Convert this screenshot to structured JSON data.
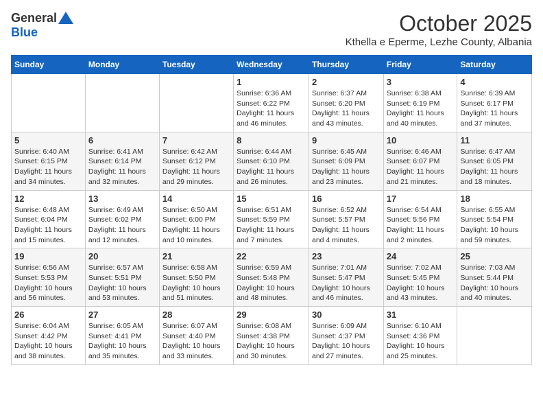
{
  "logo": {
    "general": "General",
    "blue": "Blue"
  },
  "title": "October 2025",
  "location": "Kthella e Eperme, Lezhe County, Albania",
  "weekdays": [
    "Sunday",
    "Monday",
    "Tuesday",
    "Wednesday",
    "Thursday",
    "Friday",
    "Saturday"
  ],
  "weeks": [
    [
      {
        "day": "",
        "info": ""
      },
      {
        "day": "",
        "info": ""
      },
      {
        "day": "",
        "info": ""
      },
      {
        "day": "1",
        "info": "Sunrise: 6:36 AM\nSunset: 6:22 PM\nDaylight: 11 hours and 46 minutes."
      },
      {
        "day": "2",
        "info": "Sunrise: 6:37 AM\nSunset: 6:20 PM\nDaylight: 11 hours and 43 minutes."
      },
      {
        "day": "3",
        "info": "Sunrise: 6:38 AM\nSunset: 6:19 PM\nDaylight: 11 hours and 40 minutes."
      },
      {
        "day": "4",
        "info": "Sunrise: 6:39 AM\nSunset: 6:17 PM\nDaylight: 11 hours and 37 minutes."
      }
    ],
    [
      {
        "day": "5",
        "info": "Sunrise: 6:40 AM\nSunset: 6:15 PM\nDaylight: 11 hours and 34 minutes."
      },
      {
        "day": "6",
        "info": "Sunrise: 6:41 AM\nSunset: 6:14 PM\nDaylight: 11 hours and 32 minutes."
      },
      {
        "day": "7",
        "info": "Sunrise: 6:42 AM\nSunset: 6:12 PM\nDaylight: 11 hours and 29 minutes."
      },
      {
        "day": "8",
        "info": "Sunrise: 6:44 AM\nSunset: 6:10 PM\nDaylight: 11 hours and 26 minutes."
      },
      {
        "day": "9",
        "info": "Sunrise: 6:45 AM\nSunset: 6:09 PM\nDaylight: 11 hours and 23 minutes."
      },
      {
        "day": "10",
        "info": "Sunrise: 6:46 AM\nSunset: 6:07 PM\nDaylight: 11 hours and 21 minutes."
      },
      {
        "day": "11",
        "info": "Sunrise: 6:47 AM\nSunset: 6:05 PM\nDaylight: 11 hours and 18 minutes."
      }
    ],
    [
      {
        "day": "12",
        "info": "Sunrise: 6:48 AM\nSunset: 6:04 PM\nDaylight: 11 hours and 15 minutes."
      },
      {
        "day": "13",
        "info": "Sunrise: 6:49 AM\nSunset: 6:02 PM\nDaylight: 11 hours and 12 minutes."
      },
      {
        "day": "14",
        "info": "Sunrise: 6:50 AM\nSunset: 6:00 PM\nDaylight: 11 hours and 10 minutes."
      },
      {
        "day": "15",
        "info": "Sunrise: 6:51 AM\nSunset: 5:59 PM\nDaylight: 11 hours and 7 minutes."
      },
      {
        "day": "16",
        "info": "Sunrise: 6:52 AM\nSunset: 5:57 PM\nDaylight: 11 hours and 4 minutes."
      },
      {
        "day": "17",
        "info": "Sunrise: 6:54 AM\nSunset: 5:56 PM\nDaylight: 11 hours and 2 minutes."
      },
      {
        "day": "18",
        "info": "Sunrise: 6:55 AM\nSunset: 5:54 PM\nDaylight: 10 hours and 59 minutes."
      }
    ],
    [
      {
        "day": "19",
        "info": "Sunrise: 6:56 AM\nSunset: 5:53 PM\nDaylight: 10 hours and 56 minutes."
      },
      {
        "day": "20",
        "info": "Sunrise: 6:57 AM\nSunset: 5:51 PM\nDaylight: 10 hours and 53 minutes."
      },
      {
        "day": "21",
        "info": "Sunrise: 6:58 AM\nSunset: 5:50 PM\nDaylight: 10 hours and 51 minutes."
      },
      {
        "day": "22",
        "info": "Sunrise: 6:59 AM\nSunset: 5:48 PM\nDaylight: 10 hours and 48 minutes."
      },
      {
        "day": "23",
        "info": "Sunrise: 7:01 AM\nSunset: 5:47 PM\nDaylight: 10 hours and 46 minutes."
      },
      {
        "day": "24",
        "info": "Sunrise: 7:02 AM\nSunset: 5:45 PM\nDaylight: 10 hours and 43 minutes."
      },
      {
        "day": "25",
        "info": "Sunrise: 7:03 AM\nSunset: 5:44 PM\nDaylight: 10 hours and 40 minutes."
      }
    ],
    [
      {
        "day": "26",
        "info": "Sunrise: 6:04 AM\nSunset: 4:42 PM\nDaylight: 10 hours and 38 minutes."
      },
      {
        "day": "27",
        "info": "Sunrise: 6:05 AM\nSunset: 4:41 PM\nDaylight: 10 hours and 35 minutes."
      },
      {
        "day": "28",
        "info": "Sunrise: 6:07 AM\nSunset: 4:40 PM\nDaylight: 10 hours and 33 minutes."
      },
      {
        "day": "29",
        "info": "Sunrise: 6:08 AM\nSunset: 4:38 PM\nDaylight: 10 hours and 30 minutes."
      },
      {
        "day": "30",
        "info": "Sunrise: 6:09 AM\nSunset: 4:37 PM\nDaylight: 10 hours and 27 minutes."
      },
      {
        "day": "31",
        "info": "Sunrise: 6:10 AM\nSunset: 4:36 PM\nDaylight: 10 hours and 25 minutes."
      },
      {
        "day": "",
        "info": ""
      }
    ]
  ]
}
